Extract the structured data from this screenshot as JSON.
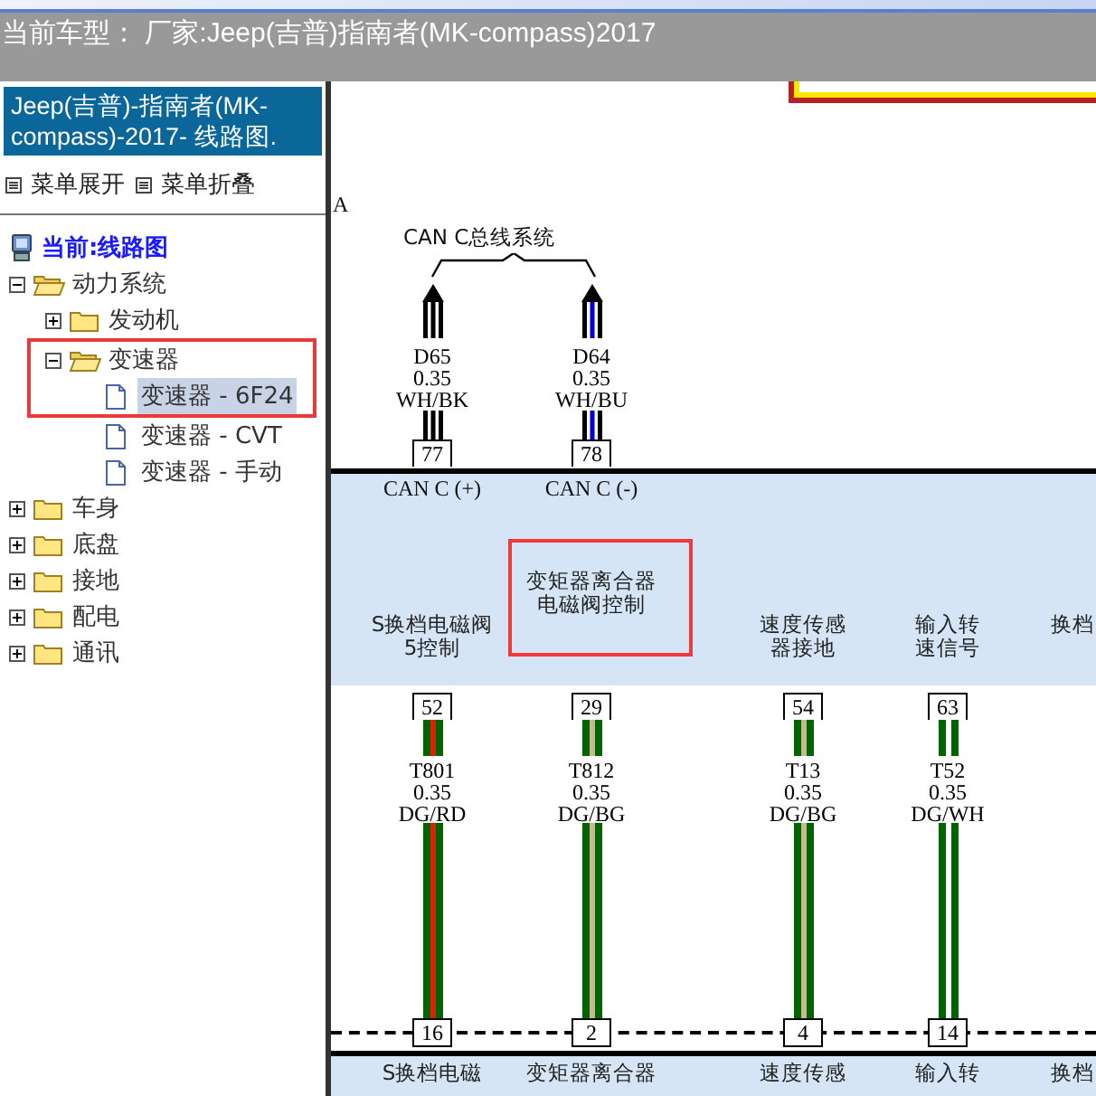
{
  "header": {
    "title": "当前车型： 厂家:Jeep(吉普)指南者(MK-compass)2017"
  },
  "sidebar": {
    "title": "Jeep(吉普)-指南者(MK-compass)-2017- 线路图.",
    "actions": [
      {
        "label": "菜单展开"
      },
      {
        "label": "菜单折叠"
      }
    ],
    "root": "当前:线路图",
    "tree": [
      {
        "label": "动力系统",
        "kind": "folder",
        "expanded": true,
        "children": [
          {
            "label": "发动机",
            "kind": "folder",
            "expanded": false
          },
          {
            "label": "变速器",
            "kind": "folder",
            "expanded": true,
            "highlighted": true,
            "children": [
              {
                "label": "变速器 - 6F24",
                "kind": "page",
                "selected": true,
                "highlighted": true
              },
              {
                "label": "变速器 - CVT",
                "kind": "page",
                "selected": false
              },
              {
                "label": "变速器 - 手动",
                "kind": "page",
                "selected": false
              }
            ]
          }
        ]
      },
      {
        "label": "车身",
        "kind": "folder",
        "expanded": false
      },
      {
        "label": "底盘",
        "kind": "folder",
        "expanded": false
      },
      {
        "label": "接地",
        "kind": "folder",
        "expanded": false
      },
      {
        "label": "配电",
        "kind": "folder",
        "expanded": false
      },
      {
        "label": "通讯",
        "kind": "folder",
        "expanded": false
      }
    ]
  },
  "diagram": {
    "corner_label": "A",
    "bus": {
      "label": "CAN C总线系统",
      "wires": [
        {
          "code": "D65",
          "gauge": "0.35",
          "color_code": "WH/BK",
          "color": "#ffffff",
          "stripe": {
            "color": "#000000"
          },
          "pin": "77",
          "pin_label": "CAN C (+)"
        },
        {
          "code": "D64",
          "gauge": "0.35",
          "color_code": "WH/BU",
          "color": "#ffffff",
          "stripe": {
            "color": "#0000dd"
          },
          "pin": "78",
          "pin_label": "CAN C (-)"
        }
      ]
    },
    "pins": [
      {
        "label": "S换档电磁阀5控制",
        "highlighted": false,
        "pin": "52",
        "code": "T801",
        "gauge": "0.35",
        "color_code": "DG/RD",
        "color": "#006400",
        "stripe": {
          "color": "#dd2200"
        },
        "bottom_pin": "16",
        "bottom_label": "S换档电磁"
      },
      {
        "label": "变矩器离合器电磁阀控制",
        "highlighted": true,
        "pin": "29",
        "code": "T812",
        "gauge": "0.35",
        "color_code": "DG/BG",
        "color": "#006400",
        "stripe": {
          "color": "#c8b890"
        },
        "bottom_pin": "2",
        "bottom_label": "变矩器离合器"
      },
      {
        "label": "速度传感器接地",
        "highlighted": false,
        "pin": "54",
        "code": "T13",
        "gauge": "0.35",
        "color_code": "DG/BG",
        "color": "#006400",
        "stripe": {
          "color": "#c8b890"
        },
        "bottom_pin": "4",
        "bottom_label": "速度传感"
      },
      {
        "label": "输入转速信号",
        "highlighted": false,
        "pin": "63",
        "code": "T52",
        "gauge": "0.35",
        "color_code": "DG/WH",
        "color": "#006400",
        "stripe": {
          "color": "#ffffff"
        },
        "bottom_pin": "14",
        "bottom_label": "输入转"
      },
      {
        "label": "换档",
        "highlighted": false,
        "bottom_label": "换档"
      }
    ]
  }
}
